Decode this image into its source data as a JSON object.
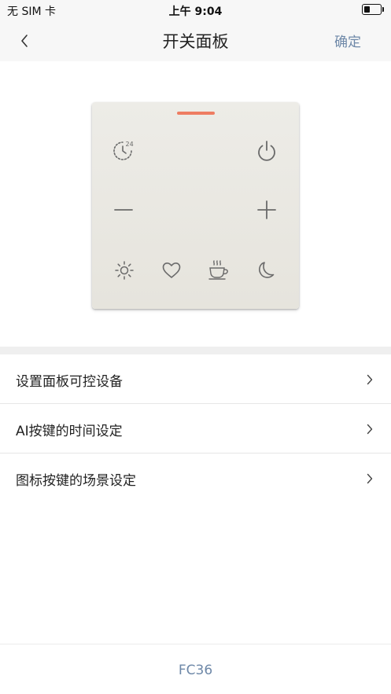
{
  "status_bar": {
    "carrier": "无 SIM 卡",
    "time": "上午 9:04",
    "battery_level": 0.35
  },
  "nav": {
    "title": "开关面板",
    "confirm_label": "确定",
    "back_icon": "chevron-left-icon"
  },
  "panel": {
    "indicator_color": "#ee7d62",
    "timer_value": "24",
    "buttons": [
      {
        "icon": "timer-icon"
      },
      {
        "icon": "power-icon"
      },
      {
        "icon": "minus-icon"
      },
      {
        "icon": "plus-icon"
      },
      {
        "icon": "sun-icon"
      },
      {
        "icon": "heart-icon"
      },
      {
        "icon": "coffee-icon"
      },
      {
        "icon": "moon-icon"
      }
    ]
  },
  "menu": {
    "items": [
      {
        "label": "设置面板可控设备"
      },
      {
        "label": "AI按键的时间设定"
      },
      {
        "label": "图标按键的场景设定"
      }
    ]
  },
  "footer": {
    "model": "FC36"
  },
  "colors": {
    "accent": "#6e88a8",
    "panel_bg": "#e9e8e2",
    "icon": "#6a6a6a"
  }
}
